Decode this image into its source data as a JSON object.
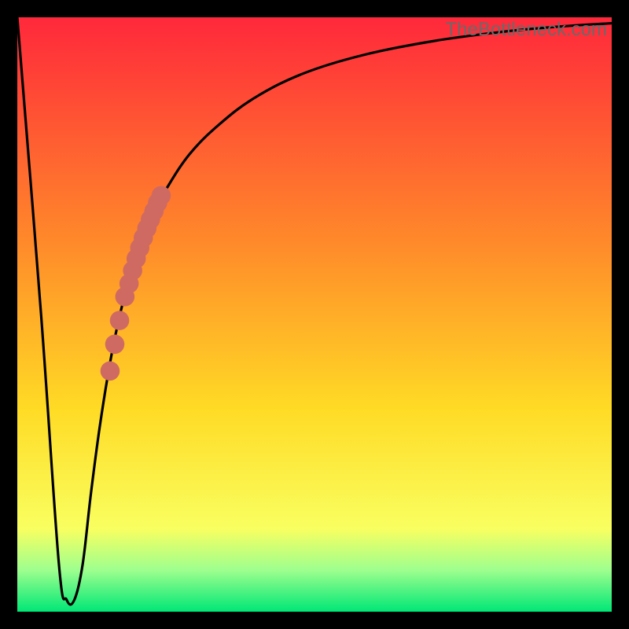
{
  "watermark": "TheBottleneck.com",
  "colors": {
    "border": "#000000",
    "curve_stroke": "#000000",
    "dot_fill": "#cf6a62",
    "gradient_top": "#ff283b",
    "gradient_mid_high": "#ff8a2a",
    "gradient_mid": "#ffdb25",
    "gradient_low": "#f9ff60",
    "gradient_green_top": "#9eff8e",
    "gradient_green_bottom": "#00e776"
  },
  "chart_data": {
    "type": "line",
    "title": "",
    "xlabel": "",
    "ylabel": "",
    "xlim": [
      0,
      100
    ],
    "ylim": [
      0,
      100
    ],
    "series": [
      {
        "name": "curve",
        "x": [
          0,
          4,
          7,
          8.3,
          9.6,
          11,
          12.4,
          14,
          16,
          18,
          20,
          22,
          25,
          29,
          34,
          40,
          48,
          58,
          70,
          82,
          92,
          100
        ],
        "y": [
          100,
          50,
          8,
          2,
          2,
          8,
          20,
          32,
          44,
          53,
          60,
          65.5,
          71,
          77,
          82,
          86.5,
          90.5,
          93.6,
          96,
          97.6,
          98.5,
          99
        ]
      }
    ],
    "points": [
      {
        "x": 15.6,
        "y": 40.5,
        "r": 1.4
      },
      {
        "x": 16.4,
        "y": 45.0,
        "r": 1.4
      },
      {
        "x": 17.2,
        "y": 49.0,
        "r": 1.4
      },
      {
        "x": 18.1,
        "y": 53.0,
        "r": 1.4
      },
      {
        "x": 18.8,
        "y": 55.2,
        "r": 1.4
      },
      {
        "x": 19.4,
        "y": 57.4,
        "r": 1.4
      },
      {
        "x": 20.0,
        "y": 59.4,
        "r": 1.4
      },
      {
        "x": 20.6,
        "y": 61.2,
        "r": 1.4
      },
      {
        "x": 21.2,
        "y": 62.9,
        "r": 1.4
      },
      {
        "x": 21.8,
        "y": 64.5,
        "r": 1.4
      },
      {
        "x": 22.4,
        "y": 66.0,
        "r": 1.4
      },
      {
        "x": 23.0,
        "y": 67.4,
        "r": 1.4
      },
      {
        "x": 23.6,
        "y": 68.8,
        "r": 1.4
      },
      {
        "x": 24.2,
        "y": 70.0,
        "r": 1.4
      }
    ]
  }
}
